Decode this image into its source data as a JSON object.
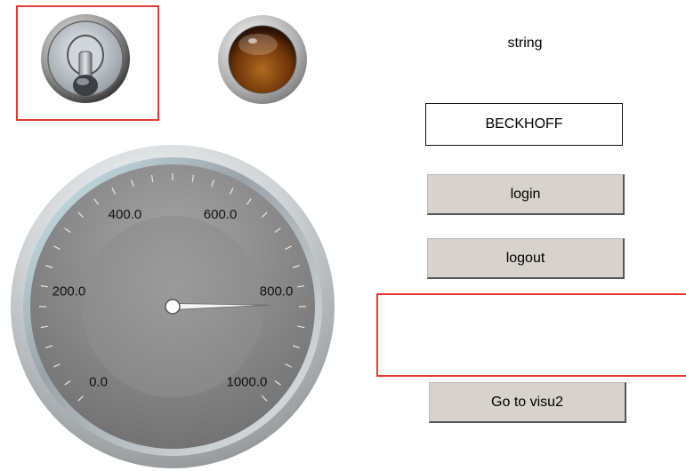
{
  "top_label": "string",
  "textbox": {
    "value": "BECKHOFF"
  },
  "buttons": {
    "login": "login",
    "logout": "logout",
    "goto_visu2": "Go to visu2"
  },
  "gauge": {
    "min": 0,
    "max": 1000,
    "value": 830,
    "scale_labels": [
      "0.0",
      "200.0",
      "400.0",
      "600.0",
      "800.0",
      "1000.0"
    ]
  },
  "icons": {
    "toggle": "toggle-switch-icon",
    "lamp": "indicator-lamp-icon"
  },
  "colors": {
    "highlight_frame": "#e53935",
    "button_face": "#d7d3cc",
    "lamp": "#7a3d0a"
  }
}
